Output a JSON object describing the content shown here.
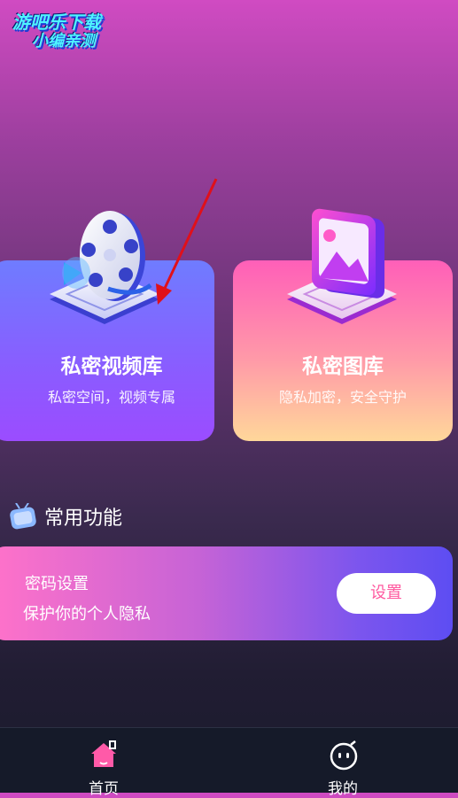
{
  "watermark": {
    "line1": "游吧乐下载",
    "line2": "小编亲测"
  },
  "cards": {
    "video": {
      "title": "私密视频库",
      "subtitle": "私密空间，视频专属"
    },
    "photo": {
      "title": "私密图库",
      "subtitle": "隐私加密，安全守护"
    }
  },
  "section": {
    "title": "常用功能"
  },
  "password": {
    "title": "密码设置",
    "subtitle": "保护你的个人隐私",
    "button": "设置"
  },
  "tabbar": {
    "home": "首页",
    "me": "我的"
  },
  "colors": {
    "accent_pink": "#ff4fa3",
    "tabbar_bg": "#151a29",
    "arrow": "#e0101a"
  }
}
